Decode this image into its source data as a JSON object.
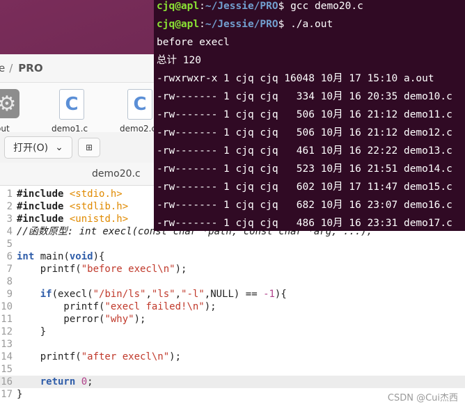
{
  "file_manager": {
    "breadcrumb_prev": "e",
    "breadcrumb_sep": "/",
    "breadcrumb_current": "PRO",
    "files": [
      {
        "label": "out",
        "icon": "gear-icon"
      },
      {
        "label": "demo1.c",
        "icon": "c-file-icon"
      },
      {
        "label": "demo2.c",
        "icon": "c-file-icon"
      }
    ],
    "c_glyph": "C"
  },
  "editor": {
    "open_button": "打开(O)",
    "tab_title": "demo20.c",
    "lines": [
      {
        "n": "1"
      },
      {
        "n": "2"
      },
      {
        "n": "3"
      },
      {
        "n": "4"
      },
      {
        "n": "5"
      },
      {
        "n": "6"
      },
      {
        "n": "7"
      },
      {
        "n": "8"
      },
      {
        "n": "9"
      },
      {
        "n": "10"
      },
      {
        "n": "11"
      },
      {
        "n": "12"
      },
      {
        "n": "13"
      },
      {
        "n": "14"
      },
      {
        "n": "15"
      },
      {
        "n": "16"
      },
      {
        "n": "17"
      }
    ],
    "code": {
      "inc1": "#include",
      "hdr1": "<stdio.h>",
      "inc2": "#include",
      "hdr2": "<stdlib.h>",
      "inc3": "#include",
      "hdr3": "<unistd.h>",
      "comment": "//函数原型: int execl(const char *path, const char *arg, ...);",
      "kw_int": "int",
      "main_rest": " main(",
      "kw_void": "void",
      "main_close": "){",
      "p1_a": "    printf(",
      "p1_s": "\"before execl\\n\"",
      "p1_b": ");",
      "if_kw": "    if",
      "if_a": "(execl(",
      "if_s1": "\"/bin/ls\"",
      "comma1": ",",
      "if_s2": "\"ls\"",
      "comma2": ",",
      "if_s3": "\"-l\"",
      "if_b": ",NULL) == ",
      "if_n": "-1",
      "if_c": "){",
      "p2_a": "        printf(",
      "p2_s": "\"execl failed!\\n\"",
      "p2_b": ");",
      "pe_a": "        perror(",
      "pe_s": "\"why\"",
      "pe_b": ");",
      "brace1": "    }",
      "p3_a": "    printf(",
      "p3_s": "\"after execl\\n\"",
      "p3_b": ");",
      "ret_kw": "    return",
      "ret_sp": " ",
      "ret_n": "0",
      "ret_semi": ";",
      "brace2": "}"
    }
  },
  "terminal": {
    "lines": [
      {
        "user": "cjq@apl",
        "colon": ":",
        "path": "~/Jessie/PRO",
        "cmd": "$ gcc demo20.c"
      },
      {
        "user": "cjq@apl",
        "colon": ":",
        "path": "~/Jessie/PRO",
        "cmd": "$ ./a.out"
      }
    ],
    "output": [
      "before execl",
      "总计 120",
      "-rwxrwxr-x 1 cjq cjq 16048 10月 17 15:10 a.out",
      "-rw------- 1 cjq cjq   334 10月 16 20:35 demo10.c",
      "-rw------- 1 cjq cjq   506 10月 16 21:12 demo11.c",
      "-rw------- 1 cjq cjq   506 10月 16 21:12 demo12.c",
      "-rw------- 1 cjq cjq   461 10月 16 22:22 demo13.c",
      "-rw------- 1 cjq cjq   523 10月 16 21:51 demo14.c",
      "-rw------- 1 cjq cjq   602 10月 17 11:47 demo15.c",
      "-rw------- 1 cjq cjq   682 10月 16 23:07 demo16.c",
      "-rw------- 1 cjq cjq   486 10月 16 23:31 demo17.c"
    ]
  },
  "watermark": "CSDN @Cui杰西"
}
